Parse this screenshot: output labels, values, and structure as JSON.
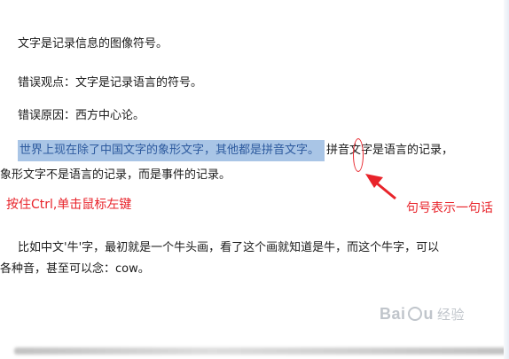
{
  "document": {
    "paragraphs": [
      "文字是记录信息的图像符号。",
      "错误观点：文字是记录语言的符号。",
      "错误原因：西方中心论。"
    ],
    "selected_text": "世界上现在除了中国文字的象形文字，其他都是拼音文字。",
    "after_selection": "拼音文字是语言的记录，",
    "line_continuation": "象形文字不是语言的记录，而是事件的记录。",
    "example_line_1": "比如中文'牛'字，最初就是一个牛头画，看了这个画就知道是牛，而这个牛字，可以",
    "example_line_2": "各种音，甚至可以念：cow。"
  },
  "annotations": {
    "ctrl_click_note": "按住Ctrl,单击鼠标左键",
    "period_note": "句号表示一句话",
    "color": "#e8232a"
  },
  "watermark": {
    "brand_left": "Bai",
    "brand_right": "u",
    "brand_sub": "经验"
  },
  "colors": {
    "selection_bg": "#a9c5e6",
    "selection_text": "#2d5a9e"
  }
}
